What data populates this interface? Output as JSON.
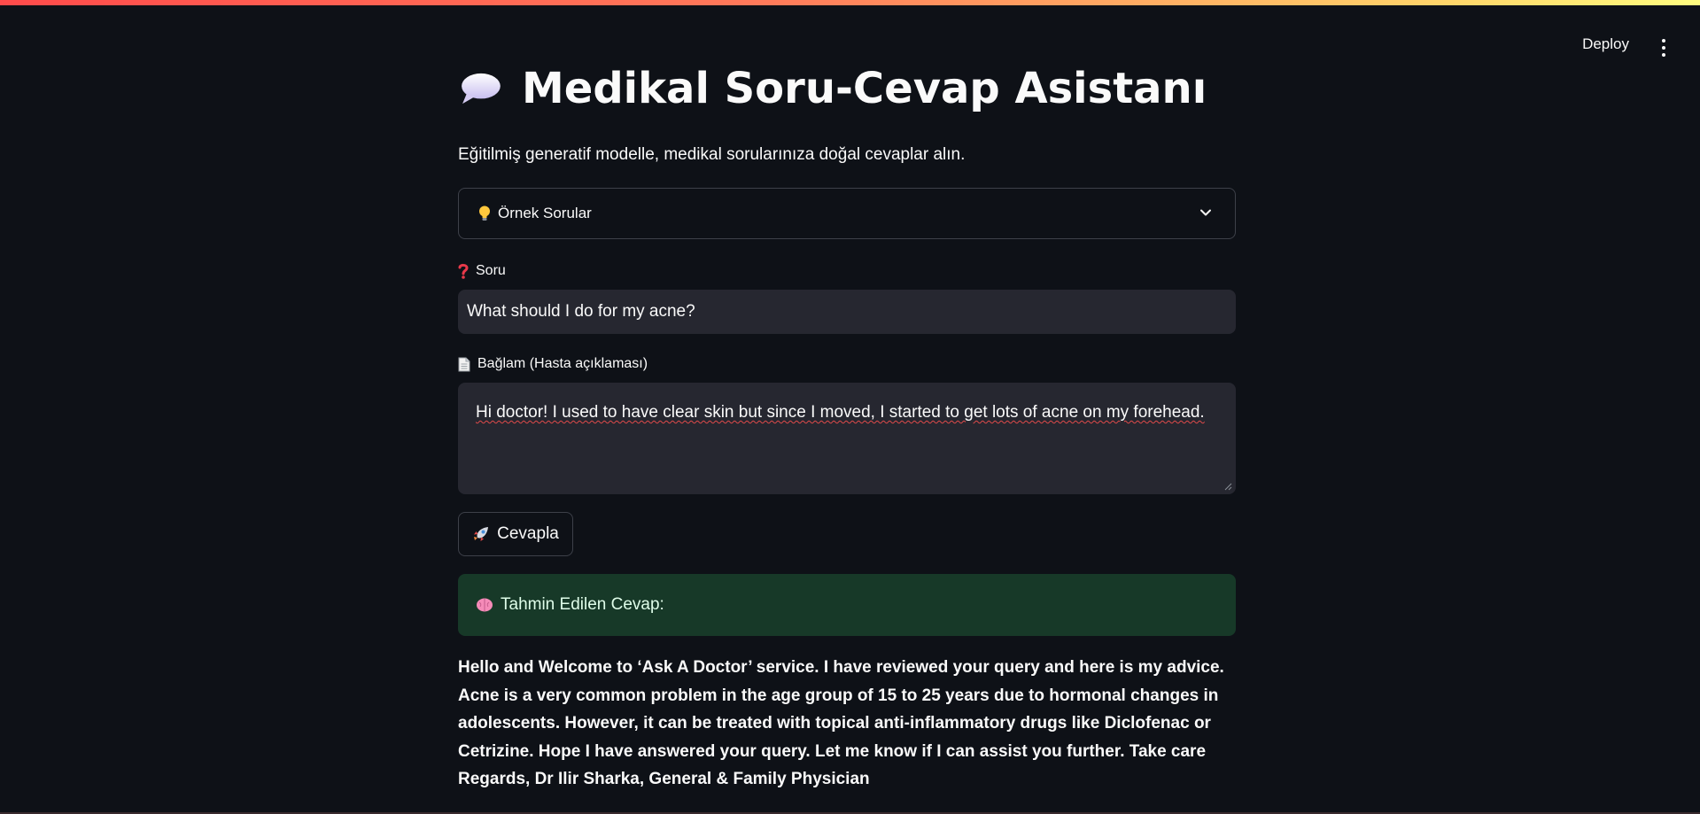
{
  "header": {
    "deploy_label": "Deploy"
  },
  "main": {
    "title": "Medikal Soru-Cevap Asistanı",
    "subtitle": "Eğitilmiş generatif modelle, medikal sorularınıza doğal cevaplar alın.",
    "examples": {
      "label": "Örnek Sorular",
      "icon": "lightbulb-icon"
    },
    "question": {
      "label": "Soru",
      "icon": "question-mark-icon",
      "value": "What should I do for my acne?"
    },
    "context": {
      "label": "Bağlam (Hasta açıklaması)",
      "icon": "page-icon",
      "value": "Hi doctor! I used to have clear skin but since I moved, I started to get lots of acne on my forehead."
    },
    "submit": {
      "label": "Cevapla",
      "icon": "rocket-icon"
    },
    "result": {
      "label": "Tahmin Edilen Cevap:",
      "icon": "brain-icon"
    },
    "answer": "Hello and Welcome to ‘Ask A Doctor’ service. I have reviewed your query and here is my advice. Acne is a very common problem in the age group of 15 to 25 years due to hormonal changes in adolescents. However, it can be treated with topical anti-inflammatory drugs like Diclofenac or Cetrizine. Hope I have answered your query. Let me know if I can assist you further. Take care Regards, Dr Ilir Sharka, General & Family Physician"
  },
  "colors": {
    "background": "#0e1117",
    "input_bg": "#262730",
    "success_bg": "#173928",
    "border": "#3d4049"
  }
}
